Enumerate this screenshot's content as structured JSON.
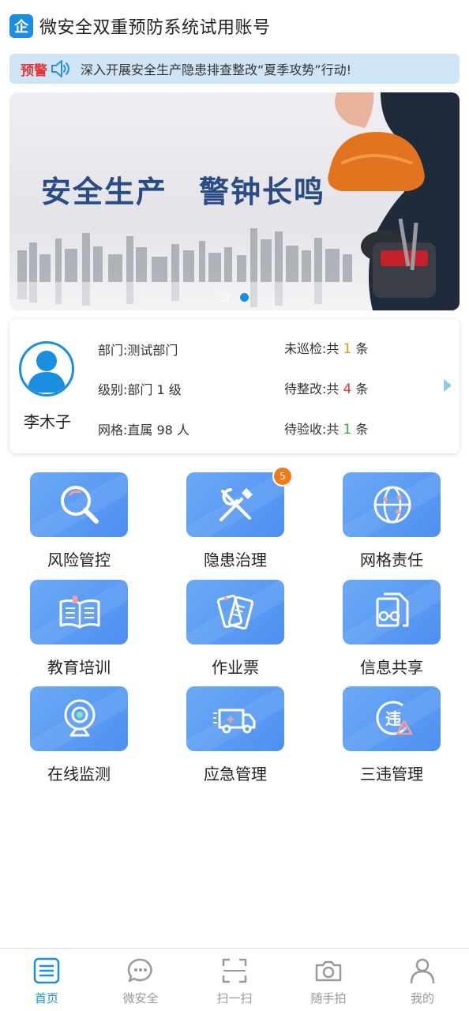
{
  "header": {
    "logo_text": "企",
    "title": "微安全双重预防系统试用账号"
  },
  "notice": {
    "tag": "预警",
    "text": "深入开展安全生产隐患排查整改“夏季攻势”行动!"
  },
  "banner": {
    "slogan_left": "安全生产",
    "slogan_right": "警钟长鸣",
    "active_slide": 2,
    "slide_count": 2
  },
  "profile": {
    "name": "李木子",
    "dept_label": "部门:",
    "dept_value": "测试部门",
    "level_label": "级别:",
    "level_value": "部门 1 级",
    "grid_label": "网格:",
    "grid_value": "直属 98 人",
    "uninspected_label": "未巡检:",
    "uninspected_prefix": "共",
    "uninspected_count": "1",
    "uninspected_suffix": "条",
    "pending_fix_label": "待整改:",
    "pending_fix_prefix": "共",
    "pending_fix_count": "4",
    "pending_fix_suffix": "条",
    "pending_check_label": "待验收:",
    "pending_check_prefix": "共",
    "pending_check_count": "1",
    "pending_check_suffix": "条"
  },
  "modules": [
    {
      "label": "风险管控",
      "icon": "magnifier-icon"
    },
    {
      "label": "隐患治理",
      "icon": "tools-icon",
      "badge": "5"
    },
    {
      "label": "网格责任",
      "icon": "globe-network-icon"
    },
    {
      "label": "教育培训",
      "icon": "open-book-icon"
    },
    {
      "label": "作业票",
      "icon": "tickets-icon"
    },
    {
      "label": "信息共享",
      "icon": "document-glasses-icon"
    },
    {
      "label": "在线监测",
      "icon": "camera-monitor-icon"
    },
    {
      "label": "应急管理",
      "icon": "ambulance-icon"
    },
    {
      "label": "三违管理",
      "icon": "violation-warning-icon"
    }
  ],
  "tabbar": [
    {
      "label": "首页",
      "icon": "home-list-icon",
      "active": true
    },
    {
      "label": "微安全",
      "icon": "chat-bubble-icon"
    },
    {
      "label": "扫一扫",
      "icon": "scan-icon"
    },
    {
      "label": "随手拍",
      "icon": "camera-icon"
    },
    {
      "label": "我的",
      "icon": "user-icon"
    }
  ],
  "colors": {
    "primary": "#1a8ee0",
    "tile": "#5b9cf3",
    "warning_red": "#e23a3a",
    "badge_orange": "#f07a1a",
    "count_orange": "#e8921a",
    "count_green": "#3aa64a"
  }
}
